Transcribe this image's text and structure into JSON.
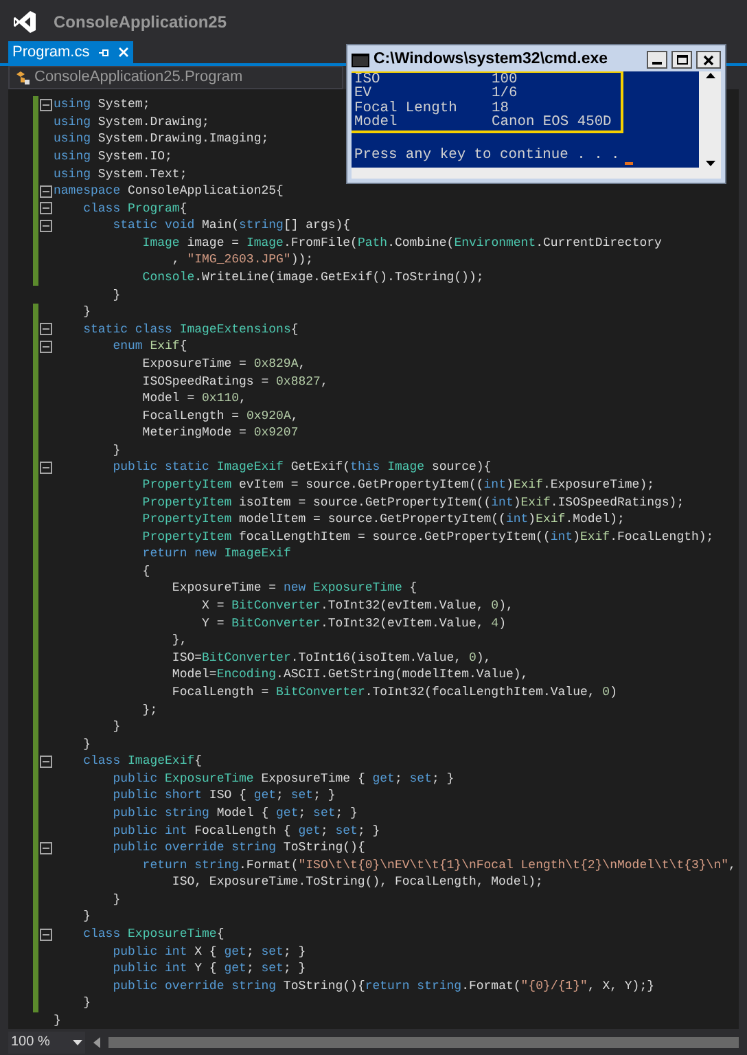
{
  "app_title": "ConsoleApplication25",
  "tab": {
    "label": "Program.cs",
    "selected": true
  },
  "nav_bar": {
    "label": "ConsoleApplication25.Program"
  },
  "code_lines": [
    {
      "fold": true,
      "changed": true,
      "tokens": [
        {
          "kind": "kw",
          "text": "using"
        },
        {
          "kind": "plain",
          "text": " System;"
        }
      ]
    },
    {
      "fold": false,
      "changed": true,
      "tokens": [
        {
          "kind": "kw",
          "text": "using"
        },
        {
          "kind": "plain",
          "text": " System.Drawing;"
        }
      ]
    },
    {
      "fold": false,
      "changed": true,
      "tokens": [
        {
          "kind": "kw",
          "text": "using"
        },
        {
          "kind": "plain",
          "text": " System.Drawing.Imaging;"
        }
      ]
    },
    {
      "fold": false,
      "changed": true,
      "tokens": [
        {
          "kind": "kw",
          "text": "using"
        },
        {
          "kind": "plain",
          "text": " System.IO;"
        }
      ]
    },
    {
      "fold": false,
      "changed": true,
      "tokens": [
        {
          "kind": "kw",
          "text": "using"
        },
        {
          "kind": "plain",
          "text": " System.Text;"
        }
      ]
    },
    {
      "fold": true,
      "changed": true,
      "tokens": [
        {
          "kind": "kw",
          "text": "namespace"
        },
        {
          "kind": "plain",
          "text": " ConsoleApplication25{"
        }
      ]
    },
    {
      "fold": true,
      "changed": true,
      "tokens": [
        {
          "kind": "kw",
          "text": "    class "
        },
        {
          "kind": "type",
          "text": "Program"
        },
        {
          "kind": "plain",
          "text": "{"
        }
      ]
    },
    {
      "fold": true,
      "changed": true,
      "tokens": [
        {
          "kind": "kw",
          "text": "        static void"
        },
        {
          "kind": "plain",
          "text": " Main("
        },
        {
          "kind": "kw",
          "text": "string"
        },
        {
          "kind": "plain",
          "text": "[] args){"
        }
      ]
    },
    {
      "fold": false,
      "changed": true,
      "tokens": [
        {
          "kind": "type",
          "text": "            Image"
        },
        {
          "kind": "plain",
          "text": " image = "
        },
        {
          "kind": "type",
          "text": "Image"
        },
        {
          "kind": "plain",
          "text": ".FromFile("
        },
        {
          "kind": "type",
          "text": "Path"
        },
        {
          "kind": "plain",
          "text": ".Combine("
        },
        {
          "kind": "type",
          "text": "Environment"
        },
        {
          "kind": "plain",
          "text": ".CurrentDirectory"
        }
      ]
    },
    {
      "fold": false,
      "changed": true,
      "tokens": [
        {
          "kind": "plain",
          "text": "                , "
        },
        {
          "kind": "str",
          "text": "\"IMG_2603.JPG\""
        },
        {
          "kind": "plain",
          "text": "));"
        }
      ]
    },
    {
      "fold": false,
      "changed": true,
      "tokens": [
        {
          "kind": "type",
          "text": "            Console"
        },
        {
          "kind": "plain",
          "text": ".WriteLine(image.GetExif().ToString());"
        }
      ]
    },
    {
      "fold": false,
      "changed": false,
      "tokens": [
        {
          "kind": "plain",
          "text": "        }"
        }
      ]
    },
    {
      "fold": false,
      "changed": true,
      "tokens": [
        {
          "kind": "plain",
          "text": "    }"
        }
      ]
    },
    {
      "fold": true,
      "changed": true,
      "tokens": [
        {
          "kind": "kw",
          "text": "    static class "
        },
        {
          "kind": "type",
          "text": "ImageExtensions"
        },
        {
          "kind": "plain",
          "text": "{"
        }
      ]
    },
    {
      "fold": true,
      "changed": true,
      "tokens": [
        {
          "kind": "kw",
          "text": "        enum "
        },
        {
          "kind": "enum",
          "text": "Exif"
        },
        {
          "kind": "plain",
          "text": "{"
        }
      ]
    },
    {
      "fold": false,
      "changed": true,
      "tokens": [
        {
          "kind": "plain",
          "text": "            ExposureTime = "
        },
        {
          "kind": "num",
          "text": "0x829A"
        },
        {
          "kind": "plain",
          "text": ","
        }
      ]
    },
    {
      "fold": false,
      "changed": true,
      "tokens": [
        {
          "kind": "plain",
          "text": "            ISOSpeedRatings = "
        },
        {
          "kind": "num",
          "text": "0x8827"
        },
        {
          "kind": "plain",
          "text": ","
        }
      ]
    },
    {
      "fold": false,
      "changed": true,
      "tokens": [
        {
          "kind": "plain",
          "text": "            Model = "
        },
        {
          "kind": "num",
          "text": "0x110"
        },
        {
          "kind": "plain",
          "text": ","
        }
      ]
    },
    {
      "fold": false,
      "changed": true,
      "tokens": [
        {
          "kind": "plain",
          "text": "            FocalLength = "
        },
        {
          "kind": "num",
          "text": "0x920A"
        },
        {
          "kind": "plain",
          "text": ","
        }
      ]
    },
    {
      "fold": false,
      "changed": true,
      "tokens": [
        {
          "kind": "plain",
          "text": "            MeteringMode = "
        },
        {
          "kind": "num",
          "text": "0x9207"
        }
      ]
    },
    {
      "fold": false,
      "changed": true,
      "tokens": [
        {
          "kind": "plain",
          "text": "        }"
        }
      ]
    },
    {
      "fold": true,
      "changed": true,
      "tokens": [
        {
          "kind": "kw",
          "text": "        public static "
        },
        {
          "kind": "type",
          "text": "ImageExif"
        },
        {
          "kind": "plain",
          "text": " GetExif("
        },
        {
          "kind": "kw",
          "text": "this "
        },
        {
          "kind": "type",
          "text": "Image"
        },
        {
          "kind": "plain",
          "text": " source){"
        }
      ]
    },
    {
      "fold": false,
      "changed": true,
      "tokens": [
        {
          "kind": "type",
          "text": "            PropertyItem"
        },
        {
          "kind": "plain",
          "text": " evItem = source.GetPropertyItem(("
        },
        {
          "kind": "kw",
          "text": "int"
        },
        {
          "kind": "plain",
          "text": ")"
        },
        {
          "kind": "enum",
          "text": "Exif"
        },
        {
          "kind": "plain",
          "text": ".ExposureTime);"
        }
      ]
    },
    {
      "fold": false,
      "changed": true,
      "tokens": [
        {
          "kind": "type",
          "text": "            PropertyItem"
        },
        {
          "kind": "plain",
          "text": " isoItem = source.GetPropertyItem(("
        },
        {
          "kind": "kw",
          "text": "int"
        },
        {
          "kind": "plain",
          "text": ")"
        },
        {
          "kind": "enum",
          "text": "Exif"
        },
        {
          "kind": "plain",
          "text": ".ISOSpeedRatings);"
        }
      ]
    },
    {
      "fold": false,
      "changed": true,
      "tokens": [
        {
          "kind": "type",
          "text": "            PropertyItem"
        },
        {
          "kind": "plain",
          "text": " modelItem = source.GetPropertyItem(("
        },
        {
          "kind": "kw",
          "text": "int"
        },
        {
          "kind": "plain",
          "text": ")"
        },
        {
          "kind": "enum",
          "text": "Exif"
        },
        {
          "kind": "plain",
          "text": ".Model);"
        }
      ]
    },
    {
      "fold": false,
      "changed": true,
      "tokens": [
        {
          "kind": "type",
          "text": "            PropertyItem"
        },
        {
          "kind": "plain",
          "text": " focalLengthItem = source.GetPropertyItem(("
        },
        {
          "kind": "kw",
          "text": "int"
        },
        {
          "kind": "plain",
          "text": ")"
        },
        {
          "kind": "enum",
          "text": "Exif"
        },
        {
          "kind": "plain",
          "text": ".FocalLength);"
        }
      ]
    },
    {
      "fold": false,
      "changed": true,
      "tokens": [
        {
          "kind": "kw",
          "text": "            return new "
        },
        {
          "kind": "type",
          "text": "ImageExif"
        }
      ]
    },
    {
      "fold": false,
      "changed": true,
      "tokens": [
        {
          "kind": "plain",
          "text": "            {"
        }
      ]
    },
    {
      "fold": false,
      "changed": true,
      "tokens": [
        {
          "kind": "plain",
          "text": "                ExposureTime = "
        },
        {
          "kind": "kw",
          "text": "new "
        },
        {
          "kind": "type",
          "text": "ExposureTime"
        },
        {
          "kind": "plain",
          "text": " {"
        }
      ]
    },
    {
      "fold": false,
      "changed": true,
      "tokens": [
        {
          "kind": "plain",
          "text": "                    X = "
        },
        {
          "kind": "type",
          "text": "BitConverter"
        },
        {
          "kind": "plain",
          "text": ".ToInt32(evItem.Value, "
        },
        {
          "kind": "num",
          "text": "0"
        },
        {
          "kind": "plain",
          "text": "),"
        }
      ]
    },
    {
      "fold": false,
      "changed": true,
      "tokens": [
        {
          "kind": "plain",
          "text": "                    Y = "
        },
        {
          "kind": "type",
          "text": "BitConverter"
        },
        {
          "kind": "plain",
          "text": ".ToInt32(evItem.Value, "
        },
        {
          "kind": "num",
          "text": "4"
        },
        {
          "kind": "plain",
          "text": ")"
        }
      ]
    },
    {
      "fold": false,
      "changed": true,
      "tokens": [
        {
          "kind": "plain",
          "text": "                },"
        }
      ]
    },
    {
      "fold": false,
      "changed": true,
      "tokens": [
        {
          "kind": "plain",
          "text": "                ISO="
        },
        {
          "kind": "type",
          "text": "BitConverter"
        },
        {
          "kind": "plain",
          "text": ".ToInt16(isoItem.Value, "
        },
        {
          "kind": "num",
          "text": "0"
        },
        {
          "kind": "plain",
          "text": "),"
        }
      ]
    },
    {
      "fold": false,
      "changed": true,
      "tokens": [
        {
          "kind": "plain",
          "text": "                Model="
        },
        {
          "kind": "type",
          "text": "Encoding"
        },
        {
          "kind": "plain",
          "text": ".ASCII.GetString(modelItem.Value),"
        }
      ]
    },
    {
      "fold": false,
      "changed": true,
      "tokens": [
        {
          "kind": "plain",
          "text": "                FocalLength = "
        },
        {
          "kind": "type",
          "text": "BitConverter"
        },
        {
          "kind": "plain",
          "text": ".ToInt32(focalLengthItem.Value, "
        },
        {
          "kind": "num",
          "text": "0"
        },
        {
          "kind": "plain",
          "text": ")"
        }
      ]
    },
    {
      "fold": false,
      "changed": true,
      "tokens": [
        {
          "kind": "plain",
          "text": "            };"
        }
      ]
    },
    {
      "fold": false,
      "changed": true,
      "tokens": [
        {
          "kind": "plain",
          "text": "        }"
        }
      ]
    },
    {
      "fold": false,
      "changed": true,
      "tokens": [
        {
          "kind": "plain",
          "text": "    }"
        }
      ]
    },
    {
      "fold": true,
      "changed": true,
      "tokens": [
        {
          "kind": "kw",
          "text": "    class "
        },
        {
          "kind": "type",
          "text": "ImageExif"
        },
        {
          "kind": "plain",
          "text": "{"
        }
      ]
    },
    {
      "fold": false,
      "changed": true,
      "tokens": [
        {
          "kind": "kw",
          "text": "        public "
        },
        {
          "kind": "type",
          "text": "ExposureTime"
        },
        {
          "kind": "plain",
          "text": " ExposureTime { "
        },
        {
          "kind": "kw",
          "text": "get"
        },
        {
          "kind": "plain",
          "text": "; "
        },
        {
          "kind": "kw",
          "text": "set"
        },
        {
          "kind": "plain",
          "text": "; }"
        }
      ]
    },
    {
      "fold": false,
      "changed": true,
      "tokens": [
        {
          "kind": "kw",
          "text": "        public short"
        },
        {
          "kind": "plain",
          "text": " ISO { "
        },
        {
          "kind": "kw",
          "text": "get"
        },
        {
          "kind": "plain",
          "text": "; "
        },
        {
          "kind": "kw",
          "text": "set"
        },
        {
          "kind": "plain",
          "text": "; }"
        }
      ]
    },
    {
      "fold": false,
      "changed": true,
      "tokens": [
        {
          "kind": "kw",
          "text": "        public string"
        },
        {
          "kind": "plain",
          "text": " Model { "
        },
        {
          "kind": "kw",
          "text": "get"
        },
        {
          "kind": "plain",
          "text": "; "
        },
        {
          "kind": "kw",
          "text": "set"
        },
        {
          "kind": "plain",
          "text": "; }"
        }
      ]
    },
    {
      "fold": false,
      "changed": true,
      "tokens": [
        {
          "kind": "kw",
          "text": "        public int"
        },
        {
          "kind": "plain",
          "text": " FocalLength { "
        },
        {
          "kind": "kw",
          "text": "get"
        },
        {
          "kind": "plain",
          "text": "; "
        },
        {
          "kind": "kw",
          "text": "set"
        },
        {
          "kind": "plain",
          "text": "; }"
        }
      ]
    },
    {
      "fold": true,
      "changed": true,
      "tokens": [
        {
          "kind": "kw",
          "text": "        public override string"
        },
        {
          "kind": "plain",
          "text": " ToString(){"
        }
      ]
    },
    {
      "fold": false,
      "changed": true,
      "tokens": [
        {
          "kind": "kw",
          "text": "            return string"
        },
        {
          "kind": "plain",
          "text": ".Format("
        },
        {
          "kind": "str",
          "text": "\"ISO\\t\\t{0}\\nEV\\t\\t{1}\\nFocal Length\\t{2}\\nModel\\t\\t{3}\\n\""
        },
        {
          "kind": "plain",
          "text": ","
        }
      ]
    },
    {
      "fold": false,
      "changed": true,
      "tokens": [
        {
          "kind": "plain",
          "text": "                ISO, ExposureTime.ToString(), FocalLength, Model);"
        }
      ]
    },
    {
      "fold": false,
      "changed": true,
      "tokens": [
        {
          "kind": "plain",
          "text": "        }"
        }
      ]
    },
    {
      "fold": false,
      "changed": true,
      "tokens": [
        {
          "kind": "plain",
          "text": "    }"
        }
      ]
    },
    {
      "fold": true,
      "changed": true,
      "tokens": [
        {
          "kind": "kw",
          "text": "    class "
        },
        {
          "kind": "type",
          "text": "ExposureTime"
        },
        {
          "kind": "plain",
          "text": "{"
        }
      ]
    },
    {
      "fold": false,
      "changed": true,
      "tokens": [
        {
          "kind": "kw",
          "text": "        public int"
        },
        {
          "kind": "plain",
          "text": " X { "
        },
        {
          "kind": "kw",
          "text": "get"
        },
        {
          "kind": "plain",
          "text": "; "
        },
        {
          "kind": "kw",
          "text": "set"
        },
        {
          "kind": "plain",
          "text": "; }"
        }
      ]
    },
    {
      "fold": false,
      "changed": true,
      "tokens": [
        {
          "kind": "kw",
          "text": "        public int"
        },
        {
          "kind": "plain",
          "text": " Y { "
        },
        {
          "kind": "kw",
          "text": "get"
        },
        {
          "kind": "plain",
          "text": "; "
        },
        {
          "kind": "kw",
          "text": "set"
        },
        {
          "kind": "plain",
          "text": "; }"
        }
      ]
    },
    {
      "fold": false,
      "changed": true,
      "tokens": [
        {
          "kind": "kw",
          "text": "        public override string"
        },
        {
          "kind": "plain",
          "text": " ToString(){"
        },
        {
          "kind": "kw",
          "text": "return string"
        },
        {
          "kind": "plain",
          "text": ".Format("
        },
        {
          "kind": "str",
          "text": "\"{0}/{1}\""
        },
        {
          "kind": "plain",
          "text": ", X, Y);}"
        }
      ]
    },
    {
      "fold": false,
      "changed": true,
      "tokens": [
        {
          "kind": "plain",
          "text": "    }"
        }
      ]
    },
    {
      "fold": false,
      "changed": false,
      "tokens": [
        {
          "kind": "plain",
          "text": "}"
        }
      ]
    }
  ],
  "console": {
    "title": "C:\\Windows\\system32\\cmd.exe",
    "rows": [
      {
        "label": "ISO",
        "value": "100"
      },
      {
        "label": "EV",
        "value": "1/6"
      },
      {
        "label": "Focal Length",
        "value": "18"
      },
      {
        "label": "Model",
        "value": "Canon EOS 450D"
      }
    ],
    "prompt": "Press any key to continue . . ."
  },
  "zoom": "100 %"
}
